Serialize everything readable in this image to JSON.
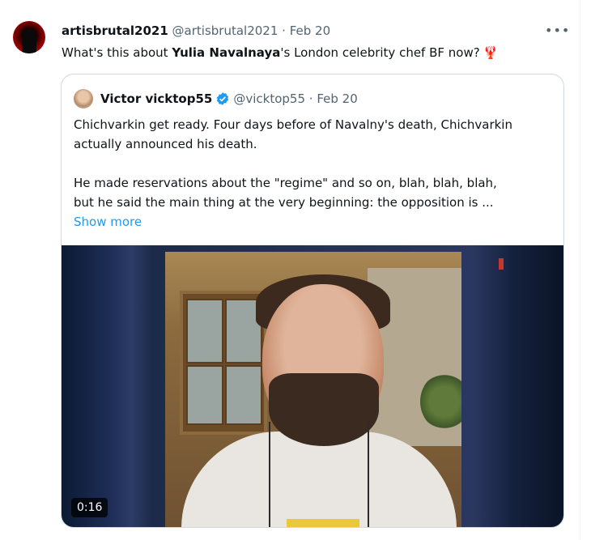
{
  "tweet": {
    "display_name": "artisbrutal2021",
    "handle": "@artisbrutal2021",
    "separator": "·",
    "date": "Feb 20",
    "more_icon": "more-horizontal-icon",
    "text_before": "What's this about ",
    "text_bold": "Yulia Navalnaya",
    "text_after": "'s London celebrity chef BF now?",
    "emoji": "🦞"
  },
  "quote": {
    "display_name": "Victor vicktop55",
    "handle": "@vicktop55",
    "separator": "·",
    "date": "Feb 20",
    "verified_icon": "verified-badge-icon",
    "lines": [
      "Chichvarkin get ready. Four days before of Navalny's death, Chichvarkin",
      "actually announced his death.",
      "",
      "He made reservations about the \"regime\" and so on, blah, blah, blah,",
      "but he said the main thing at the very beginning: the opposition is ..."
    ],
    "show_more": "Show more",
    "video": {
      "duration": "0:16"
    }
  },
  "colors": {
    "link": "#1d9bf0",
    "muted": "#536471",
    "border": "#cfd9de"
  }
}
